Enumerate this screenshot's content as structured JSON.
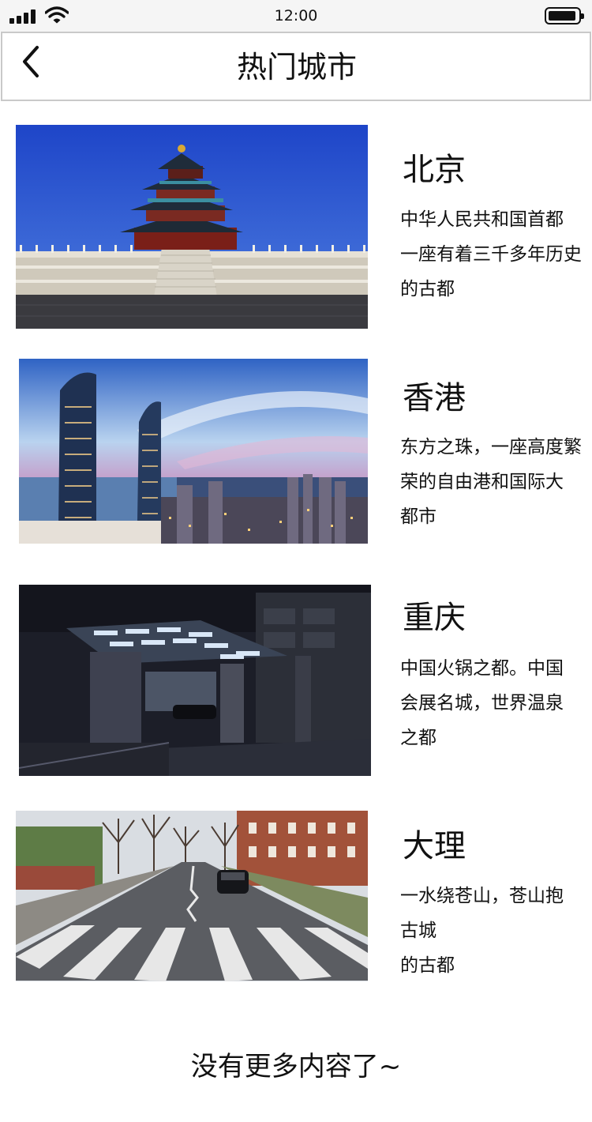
{
  "status_bar": {
    "time": "12:00",
    "icons": [
      "signal-icon",
      "wifi-icon",
      "battery-icon"
    ]
  },
  "nav": {
    "back_icon": "chevron-left-icon",
    "title": "热门城市"
  },
  "cities": [
    {
      "name": "北京",
      "description": "中华人民共和国首都\n一座有着三千多年历史\n的古都",
      "image": "temple-of-heaven-photo"
    },
    {
      "name": "香港",
      "description": "东方之珠，一座高度繁\n荣的自由港和国际大\n都市",
      "image": "harbour-skyline-photo"
    },
    {
      "name": "重庆",
      "description": "中国火锅之都。中国\n会展名城，世界温泉\n之都",
      "image": "night-plaza-photo"
    },
    {
      "name": "大理",
      "description": "一水绕苍山，苍山抱\n古城\n的古都",
      "image": "street-crosswalk-photo"
    }
  ],
  "footer": {
    "end_text": "没有更多内容了~"
  }
}
